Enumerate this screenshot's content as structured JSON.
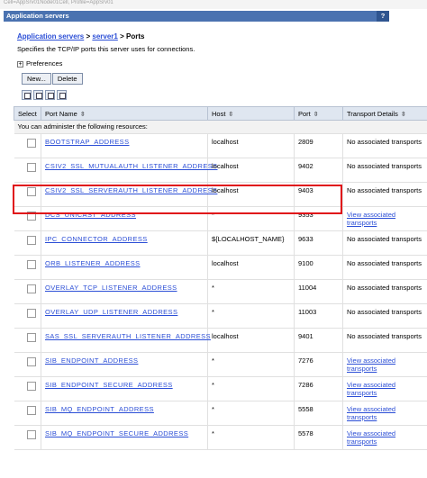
{
  "top_strip": "Cell=AppSrv01Node01Cell, Profile=AppSrv01",
  "panel": {
    "title": "Application servers",
    "help": "?"
  },
  "breadcrumb": {
    "link1": "Application servers",
    "sep1": " > ",
    "link2": "server1",
    "sep2": " > ",
    "current": "Ports"
  },
  "description": "Specifies the TCP/IP ports this server uses for connections.",
  "preferences": {
    "label": "Preferences",
    "toggle": "+"
  },
  "buttons": {
    "new": "New...",
    "delete": "Delete"
  },
  "tools": [
    "select-all-icon",
    "deselect-all-icon",
    "show-filter-icon",
    "clear-filter-icon"
  ],
  "table": {
    "headers": {
      "select": "Select",
      "port_name": "Port Name",
      "host": "Host",
      "port": "Port",
      "transport": "Transport Details"
    },
    "sort_icon": "⇳",
    "info": "You can administer the following resources:",
    "rows": [
      {
        "name": "BOOTSTRAP_ADDRESS",
        "host": "localhost",
        "port": "2809",
        "transport": "No associated transports",
        "transport_link": false
      },
      {
        "name": "CSIV2_SSL_MUTUALAUTH_LISTENER_ADDRESS",
        "host": "localhost",
        "port": "9402",
        "transport": "No associated transports",
        "transport_link": false
      },
      {
        "name": "CSIV2_SSL_SERVERAUTH_LISTENER_ADDRESS",
        "host": "localhost",
        "port": "9403",
        "transport": "No associated transports",
        "transport_link": false,
        "highlighted": true
      },
      {
        "name": "DCS_UNICAST_ADDRESS",
        "host": "*",
        "port": "9353",
        "transport": "View associated transports",
        "transport_link": true
      },
      {
        "name": "IPC_CONNECTOR_ADDRESS",
        "host": "${LOCALHOST_NAME}",
        "port": "9633",
        "transport": "No associated transports",
        "transport_link": false
      },
      {
        "name": "ORB_LISTENER_ADDRESS",
        "host": "localhost",
        "port": "9100",
        "transport": "No associated transports",
        "transport_link": false
      },
      {
        "name": "OVERLAY_TCP_LISTENER_ADDRESS",
        "host": "*",
        "port": "11004",
        "transport": "No associated transports",
        "transport_link": false
      },
      {
        "name": "OVERLAY_UDP_LISTENER_ADDRESS",
        "host": "*",
        "port": "11003",
        "transport": "No associated transports",
        "transport_link": false
      },
      {
        "name": "SAS_SSL_SERVERAUTH_LISTENER_ADDRESS",
        "host": "localhost",
        "port": "9401",
        "transport": "No associated transports",
        "transport_link": false
      },
      {
        "name": "SIB_ENDPOINT_ADDRESS",
        "host": "*",
        "port": "7276",
        "transport": "View associated transports",
        "transport_link": true
      },
      {
        "name": "SIB_ENDPOINT_SECURE_ADDRESS",
        "host": "*",
        "port": "7286",
        "transport": "View associated transports",
        "transport_link": true
      },
      {
        "name": "SIB_MQ_ENDPOINT_ADDRESS",
        "host": "*",
        "port": "5558",
        "transport": "View associated transports",
        "transport_link": true
      },
      {
        "name": "SIB_MQ_ENDPOINT_SECURE_ADDRESS",
        "host": "*",
        "port": "5578",
        "transport": "View associated transports",
        "transport_link": true
      }
    ]
  },
  "colors": {
    "title_bg": "#4a72b0",
    "link": "#2b4ed6",
    "highlight_border": "#e01018",
    "header_bg": "#dfe6f0"
  }
}
